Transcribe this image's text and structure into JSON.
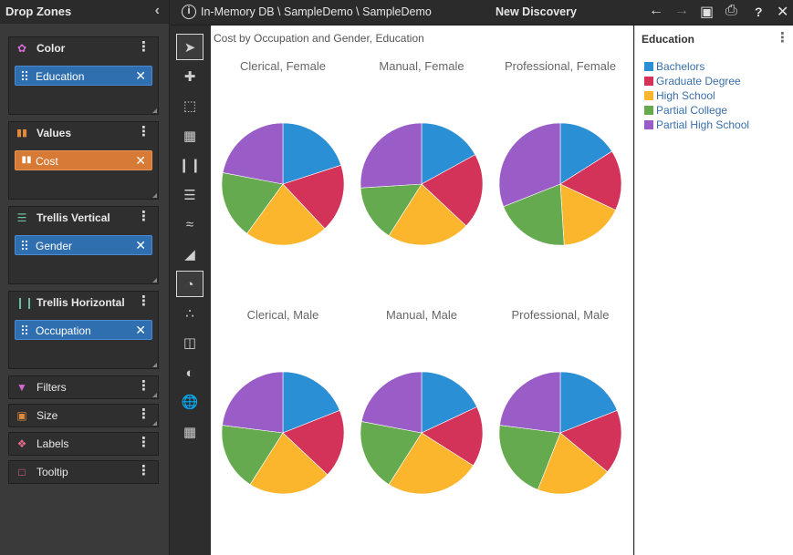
{
  "left_panel": {
    "title": "Drop Zones",
    "zones": {
      "color": {
        "label": "Color",
        "field": "Education"
      },
      "values": {
        "label": "Values",
        "field": "Cost"
      },
      "trellis_vertical": {
        "label": "Trellis Vertical",
        "field": "Gender"
      },
      "trellis_horizontal": {
        "label": "Trellis Horizontal",
        "field": "Occupation"
      },
      "filters": {
        "label": "Filters"
      },
      "size": {
        "label": "Size"
      },
      "labels": {
        "label": "Labels"
      },
      "tooltip": {
        "label": "Tooltip"
      }
    }
  },
  "topbar": {
    "path": "In-Memory DB \\ SampleDemo \\ SampleDemo",
    "title": "New Discovery"
  },
  "colors": {
    "Bachelors": "#2b8fd6",
    "Graduate Degree": "#d33358",
    "High School": "#fbb62e",
    "Partial College": "#66aa4f",
    "Partial High School": "#9a5cc6"
  },
  "chart_data": {
    "type": "pie",
    "title": "Cost by Occupation and Gender, Education",
    "legend_title": "Education",
    "legend_position": "right",
    "categories": [
      "Bachelors",
      "Graduate Degree",
      "High School",
      "Partial College",
      "Partial High School"
    ],
    "panels": [
      {
        "label": "Clerical, Female",
        "values": [
          20,
          18,
          22,
          18,
          22
        ]
      },
      {
        "label": "Manual, Female",
        "values": [
          17,
          20,
          22,
          15,
          26
        ]
      },
      {
        "label": "Professional, Female",
        "values": [
          16,
          16,
          17,
          20,
          31
        ]
      },
      {
        "label": "Clerical, Male",
        "values": [
          19,
          18,
          22,
          18,
          23
        ]
      },
      {
        "label": "Manual, Male",
        "values": [
          18,
          16,
          25,
          19,
          22
        ]
      },
      {
        "label": "Professional, Male",
        "values": [
          19,
          17,
          20,
          21,
          23
        ]
      }
    ]
  }
}
